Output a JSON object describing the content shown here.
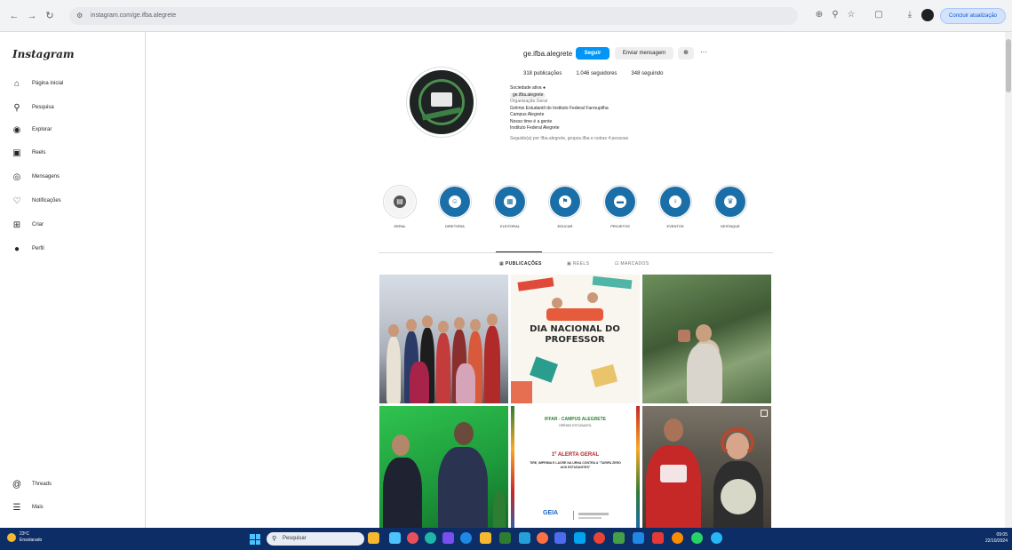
{
  "browser": {
    "url": "instagram.com/ge.ifba.alegrete",
    "update_label": "Concluir atualização",
    "icons": [
      "back-icon",
      "forward-icon",
      "reload-icon",
      "site-info-icon",
      "translate-icon",
      "zoom-icon",
      "bookmark-star-icon",
      "tab-search-icon",
      "download-icon",
      "profile-icon",
      "menu-icon"
    ]
  },
  "sidebar": {
    "logo": "Instagram",
    "items": [
      {
        "label": "Página inicial",
        "icon": "home-icon"
      },
      {
        "label": "Pesquisa",
        "icon": "search-icon"
      },
      {
        "label": "Explorar",
        "icon": "compass-icon"
      },
      {
        "label": "Reels",
        "icon": "reels-icon"
      },
      {
        "label": "Mensagens",
        "icon": "messenger-icon"
      },
      {
        "label": "Notificações",
        "icon": "heart-icon"
      },
      {
        "label": "Criar",
        "icon": "create-icon"
      },
      {
        "label": "Perfil",
        "icon": "profile-avatar-icon"
      }
    ],
    "bottom_items": [
      {
        "label": "Threads",
        "icon": "threads-icon"
      },
      {
        "label": "Mais",
        "icon": "hamburger-icon"
      }
    ]
  },
  "profile": {
    "username": "ge.ifba.alegrete",
    "follow_label": "Seguir",
    "message_label": "Enviar mensagem",
    "stats": {
      "posts": "318 publicações",
      "followers": "1.046 seguidores",
      "following": "348 seguindo"
    },
    "bio_lines": [
      "Sociedade ativa ●",
      "ge.ifba.alegrete",
      "Organização Geral",
      "Grêmio Estudantil do Instituto Federal Farroupilha",
      "Campus Alegrete",
      "Nosso time é a gente",
      "Instituto Federal Alegrete"
    ],
    "followed_by": "Seguido(a) por ifba.alegrete, grupos.ifba e outras 4 pessoas"
  },
  "highlights": [
    {
      "label": "GERAL",
      "icon": "highlight-cover-icon"
    },
    {
      "label": "DIRETORIA",
      "icon": "users-icon"
    },
    {
      "label": "ELEITORAL",
      "icon": "ballot-icon"
    },
    {
      "label": "EDUCAR",
      "icon": "flag-icon"
    },
    {
      "label": "PROJETOS",
      "icon": "car-icon"
    },
    {
      "label": "EVENTOS",
      "icon": "lightbulb-icon"
    },
    {
      "label": "DESTAQUE",
      "icon": "trophy-icon"
    }
  ],
  "tabs": [
    {
      "label": "PUBLICAÇÕES",
      "icon": "grid-icon",
      "active": true
    },
    {
      "label": "REELS",
      "icon": "reels-small-icon",
      "active": false
    },
    {
      "label": "MARCADOS",
      "icon": "tagged-icon",
      "active": false
    }
  ],
  "posts": [
    {
      "name": "post-group-photo",
      "caption": ""
    },
    {
      "name": "post-dia-professor",
      "caption": "DIA NACIONAL DO PROFESSOR"
    },
    {
      "name": "post-forest-photo",
      "caption": ""
    },
    {
      "name": "post-green-screen",
      "caption": ""
    },
    {
      "name": "post-alerta-geral",
      "caption": "1º ALERTA GERAL",
      "header": "IFFAR - CAMPUS ALEGRETE",
      "subheader": "GRÊMIO ESTUDANTIL",
      "body": "TIRE, IMPRIMA E LACRE NA URNA CONTRA A \"TARIFA ZERO AOS ESTUDANTES\"",
      "logo": "GEIA"
    },
    {
      "name": "post-two-students",
      "caption": ""
    }
  ],
  "taskbar": {
    "weather_temp": "23ºC",
    "weather_desc": "Ensolarado",
    "search_placeholder": "Pesquisar",
    "time": "09:05",
    "date": "22/10/2024"
  },
  "colors": {
    "accent_blue": "#0095f6",
    "highlight_blue": "#1b6fa8",
    "taskbar": "#0c2d66"
  }
}
